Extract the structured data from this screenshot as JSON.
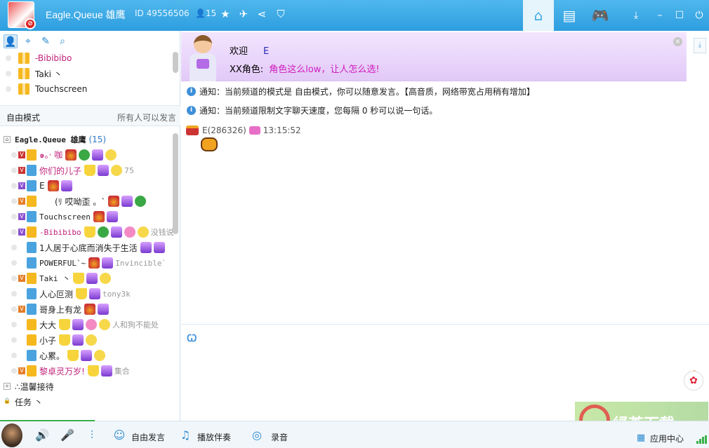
{
  "header": {
    "app_name": "Eagle.Queue 雄鹰",
    "id_text": "ID 49556506",
    "user_count": "15"
  },
  "left_panel": {
    "mic_queue": [
      {
        "name": "-Bibibibo"
      },
      {
        "name": "Taki 丶"
      },
      {
        "name": "Touchscreen"
      }
    ],
    "mode_label": "自由模式",
    "mode_desc": "所有人可以发言",
    "channel": {
      "name": "Eagle.Queue 雄鹰",
      "count": "(15)"
    },
    "users": [
      {
        "name": "๑。· 咖",
        "vip": "V",
        "role": "gold",
        "suffix": ""
      },
      {
        "name": "你们的儿子",
        "vip": "V",
        "role": "blue",
        "suffix": "75"
      },
      {
        "name": "E",
        "vip": "V",
        "role": "blue",
        "suffix": ""
      },
      {
        "name": "(ﾘ 哎呦歪 。`",
        "vip": "V",
        "role": "gold",
        "suffix": ""
      },
      {
        "name": "Touchscreen",
        "vip": "V",
        "role": "blue",
        "suffix": ""
      },
      {
        "name": "-Bibibibo",
        "vip": "V",
        "role": "gold",
        "suffix": "没钱说"
      },
      {
        "name": "1人居于心底而消失于生活",
        "vip": "",
        "role": "blue",
        "suffix": ""
      },
      {
        "name": "POWERFUL`~",
        "vip": "",
        "role": "blue",
        "suffix": "Invincible`"
      },
      {
        "name": "Taki 丶",
        "vip": "V",
        "role": "gold",
        "suffix": ""
      },
      {
        "name": "人心叵测",
        "vip": "",
        "role": "blue",
        "suffix": "tony3k"
      },
      {
        "name": "哥身上有龙",
        "vip": "V",
        "role": "blue",
        "suffix": ""
      },
      {
        "name": "大大",
        "vip": "",
        "role": "gold",
        "suffix": "人和狗不能处"
      },
      {
        "name": "小子",
        "vip": "",
        "role": "gold",
        "suffix": ""
      },
      {
        "name": "心累。",
        "vip": "",
        "role": "blue",
        "suffix": ""
      },
      {
        "name": "黎卓灵万岁!",
        "vip": "V",
        "role": "gold",
        "suffix": "集合"
      }
    ],
    "groups": [
      {
        "name": "∴温馨接待",
        "expander": "+"
      },
      {
        "name": "任务 丶",
        "expander": "🔒"
      }
    ]
  },
  "chat": {
    "welcome": {
      "label": "欢迎",
      "name": "E",
      "role_label": "XX角色:",
      "message": "角色这么low，让人怎么选!"
    },
    "notices": [
      "通知：当前频道的模式是 自由模式，你可以随意发言。【高音质，网络带宽占用稍有增加】",
      "通知：当前频道限制文字聊天速度，您每隔 0 秒可以说一句话。"
    ],
    "message": {
      "sender": "E(286326)",
      "time": "13:15:52"
    }
  },
  "bottom": {
    "free_speech": "自由发言",
    "play_music": "播放伴奏",
    "record": "录音",
    "app_center": "应用中心"
  },
  "watermark": {
    "text": "绿茶下载"
  },
  "colors": {
    "title_bar": "#2e9ee0",
    "accent": "#3da8e6",
    "welcome_bg": "#e2c9f7",
    "name_red": "#c0227a",
    "message_pink": "#d01cbd"
  }
}
